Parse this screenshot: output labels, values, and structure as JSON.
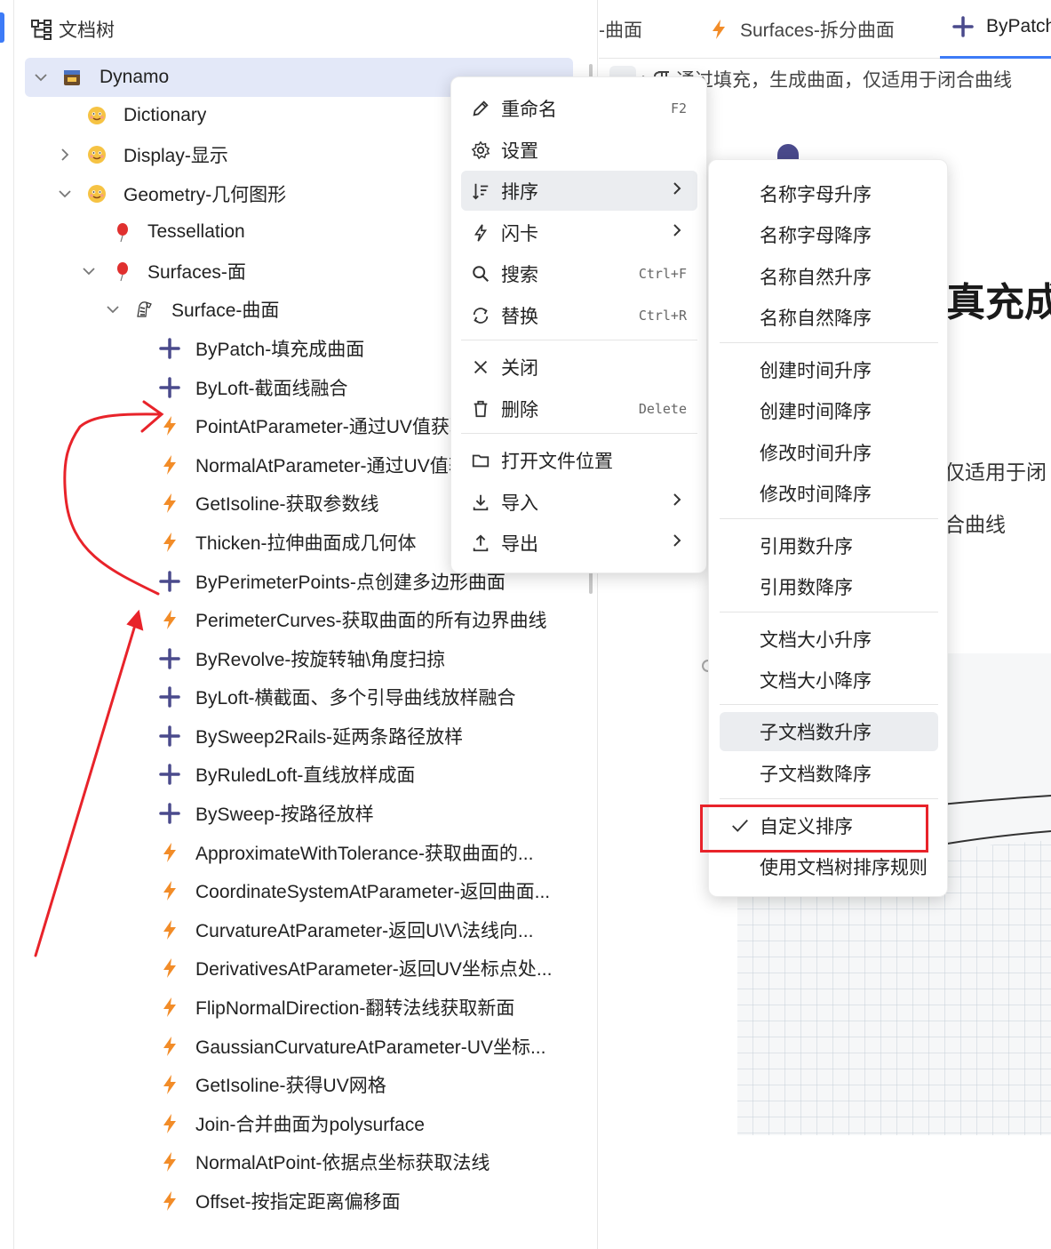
{
  "sidebar": {
    "header": "文档树",
    "tree": [
      {
        "label": "Dynamo",
        "icon": "notebook-icon",
        "toggle": "expanded",
        "level": 0,
        "selected": true
      },
      {
        "label": "Dictionary",
        "icon": "smiley-emoji-icon",
        "toggle": "none",
        "level": 1
      },
      {
        "label": "Display-显示",
        "icon": "smiley-emoji-icon",
        "toggle": "collapsed",
        "level": 1
      },
      {
        "label": "Geometry-几何图形",
        "icon": "smiley-emoji-icon",
        "toggle": "expanded",
        "level": 1
      },
      {
        "label": "Tessellation",
        "icon": "balloon-icon",
        "toggle": "none",
        "level": 2
      },
      {
        "label": "Surfaces-面",
        "icon": "balloon-icon",
        "toggle": "expanded",
        "level": 2
      },
      {
        "label": "Surface-曲面",
        "icon": "zebra-icon",
        "toggle": "expanded",
        "level": 3
      },
      {
        "label": "ByPatch-填充成曲面",
        "icon": "plus-icon",
        "toggle": "none",
        "level": 4
      },
      {
        "label": "ByLoft-截面线融合",
        "icon": "plus-icon",
        "toggle": "none",
        "level": 4
      },
      {
        "label": "PointAtParameter-通过UV值获取点",
        "icon": "lightning-icon",
        "toggle": "none",
        "level": 4
      },
      {
        "label": "NormalAtParameter-通过UV值获取法线",
        "icon": "lightning-icon",
        "toggle": "none",
        "level": 4
      },
      {
        "label": "GetIsoline-获取参数线",
        "icon": "lightning-icon",
        "toggle": "none",
        "level": 4
      },
      {
        "label": "Thicken-拉伸曲面成几何体",
        "icon": "lightning-icon",
        "toggle": "none",
        "level": 4
      },
      {
        "label": "ByPerimeterPoints-点创建多边形曲面",
        "icon": "plus-icon",
        "toggle": "none",
        "level": 4
      },
      {
        "label": "PerimeterCurves-获取曲面的所有边界曲线",
        "icon": "lightning-icon",
        "toggle": "none",
        "level": 4
      },
      {
        "label": "ByRevolve-按旋转轴\\角度扫掠",
        "icon": "plus-icon",
        "toggle": "none",
        "level": 4
      },
      {
        "label": "ByLoft-横截面、多个引导曲线放样融合",
        "icon": "plus-icon",
        "toggle": "none",
        "level": 4
      },
      {
        "label": "BySweep2Rails-延两条路径放样",
        "icon": "plus-icon",
        "toggle": "none",
        "level": 4
      },
      {
        "label": "ByRuledLoft-直线放样成面",
        "icon": "plus-icon",
        "toggle": "none",
        "level": 4
      },
      {
        "label": "BySweep-按路径放样",
        "icon": "plus-icon",
        "toggle": "none",
        "level": 4
      },
      {
        "label": "ApproximateWithTolerance-获取曲面的...",
        "icon": "lightning-icon",
        "toggle": "none",
        "level": 4
      },
      {
        "label": "CoordinateSystemAtParameter-返回曲面...",
        "icon": "lightning-icon",
        "toggle": "none",
        "level": 4
      },
      {
        "label": "CurvatureAtParameter-返回U\\V\\法线向...",
        "icon": "lightning-icon",
        "toggle": "none",
        "level": 4
      },
      {
        "label": "DerivativesAtParameter-返回UV坐标点处...",
        "icon": "lightning-icon",
        "toggle": "none",
        "level": 4
      },
      {
        "label": "FlipNormalDirection-翻转法线获取新面",
        "icon": "lightning-icon",
        "toggle": "none",
        "level": 4
      },
      {
        "label": "GaussianCurvatureAtParameter-UV坐标...",
        "icon": "lightning-icon",
        "toggle": "none",
        "level": 4
      },
      {
        "label": "GetIsoline-获得UV网格",
        "icon": "lightning-icon",
        "toggle": "none",
        "level": 4
      },
      {
        "label": "Join-合并曲面为polysurface",
        "icon": "lightning-icon",
        "toggle": "none",
        "level": 4
      },
      {
        "label": "NormalAtPoint-依据点坐标获取法线",
        "icon": "lightning-icon",
        "toggle": "none",
        "level": 4
      },
      {
        "label": "Offset-按指定距离偏移面",
        "icon": "lightning-icon",
        "toggle": "none",
        "level": 4
      }
    ]
  },
  "tabs": [
    {
      "label": "-曲面",
      "icon": ""
    },
    {
      "label": "Surfaces-拆分曲面",
      "icon": "lightning-icon"
    },
    {
      "label": "ByPatch",
      "icon": "plus-icon"
    }
  ],
  "breadcrumb": "通过填充，生成曲面，仅适用于闭合曲线",
  "document": {
    "title_fragment": "真充成",
    "line1_fragment": "仅适用于闭",
    "line2_fragment": "合曲线"
  },
  "context_menu": {
    "items": [
      {
        "label": "重命名",
        "icon": "pencil-icon",
        "shortcut": "F2",
        "submenu": false
      },
      {
        "label": "设置",
        "icon": "gear-icon",
        "shortcut": "",
        "submenu": false
      },
      {
        "label": "排序",
        "icon": "sort-icon",
        "shortcut": "",
        "submenu": true,
        "hover": true
      },
      {
        "label": "闪卡",
        "icon": "flash-icon",
        "shortcut": "",
        "submenu": true
      },
      {
        "label": "搜索",
        "icon": "search-icon",
        "shortcut": "Ctrl+F",
        "submenu": false
      },
      {
        "label": "替换",
        "icon": "replace-icon",
        "shortcut": "Ctrl+R",
        "submenu": false
      },
      {
        "label": "关闭",
        "icon": "close-icon",
        "shortcut": "",
        "submenu": false
      },
      {
        "label": "删除",
        "icon": "trash-icon",
        "shortcut": "Delete",
        "submenu": false
      },
      {
        "label": "打开文件位置",
        "icon": "folder-icon",
        "shortcut": "",
        "submenu": false
      },
      {
        "label": "导入",
        "icon": "import-icon",
        "shortcut": "",
        "submenu": true
      },
      {
        "label": "导出",
        "icon": "export-icon",
        "shortcut": "",
        "submenu": true
      }
    ]
  },
  "sort_submenu": {
    "groups": [
      [
        "名称字母升序",
        "名称字母降序",
        "名称自然升序",
        "名称自然降序"
      ],
      [
        "创建时间升序",
        "创建时间降序",
        "修改时间升序",
        "修改时间降序"
      ],
      [
        "引用数升序",
        "引用数降序"
      ],
      [
        "文档大小升序",
        "文档大小降序"
      ],
      [
        "子文档数升序",
        "子文档数降序"
      ],
      [
        "自定义排序",
        "使用文档树排序规则"
      ]
    ],
    "hovered": "子文档数升序",
    "checked": "自定义排序"
  },
  "colors": {
    "accent": "#3d7bf7",
    "plus_icon": "#4a4a8c",
    "lightning_icon": "#f28c28",
    "annotation_red": "#e8232a",
    "selected_row": "#e3e8f8"
  }
}
